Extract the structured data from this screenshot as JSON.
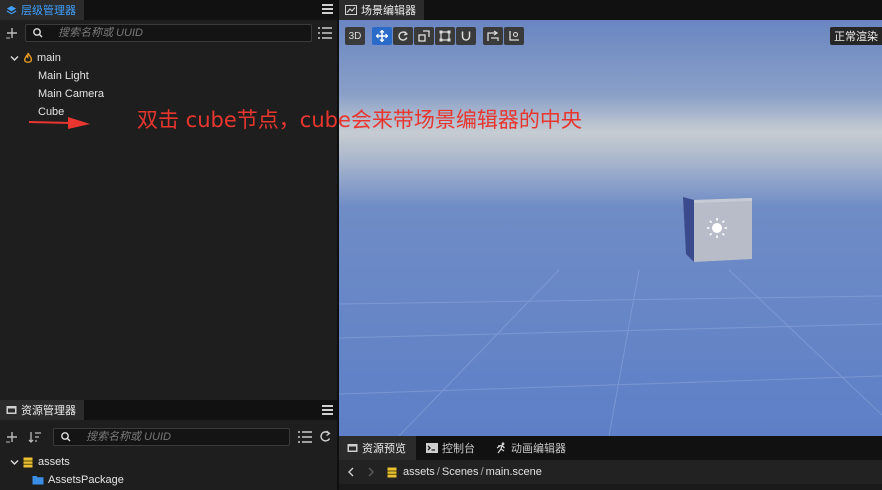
{
  "hierarchy": {
    "title": "层级管理器",
    "search_placeholder": "搜索名称或 UUID",
    "root": "main",
    "children": [
      "Main Light",
      "Main Camera",
      "Cube"
    ]
  },
  "assets": {
    "title": "资源管理器",
    "search_placeholder": "搜索名称或 UUID",
    "root": "assets",
    "children": [
      "AssetsPackage"
    ]
  },
  "scene": {
    "title": "场景编辑器",
    "mode_3d": "3D",
    "render_mode": "正常渲染"
  },
  "annotation": {
    "text": "双击 cube节点，cube会来带场景编辑器的中央",
    "color": "#e8362f"
  },
  "bottom": {
    "tabs": [
      "资源预览",
      "控制台",
      "动画编辑器"
    ],
    "path_parts": [
      "assets",
      "Scenes",
      "main.scene"
    ]
  },
  "colors": {
    "accent": "#2a6ac8",
    "hierarchy_title": "#3fa0ff"
  }
}
